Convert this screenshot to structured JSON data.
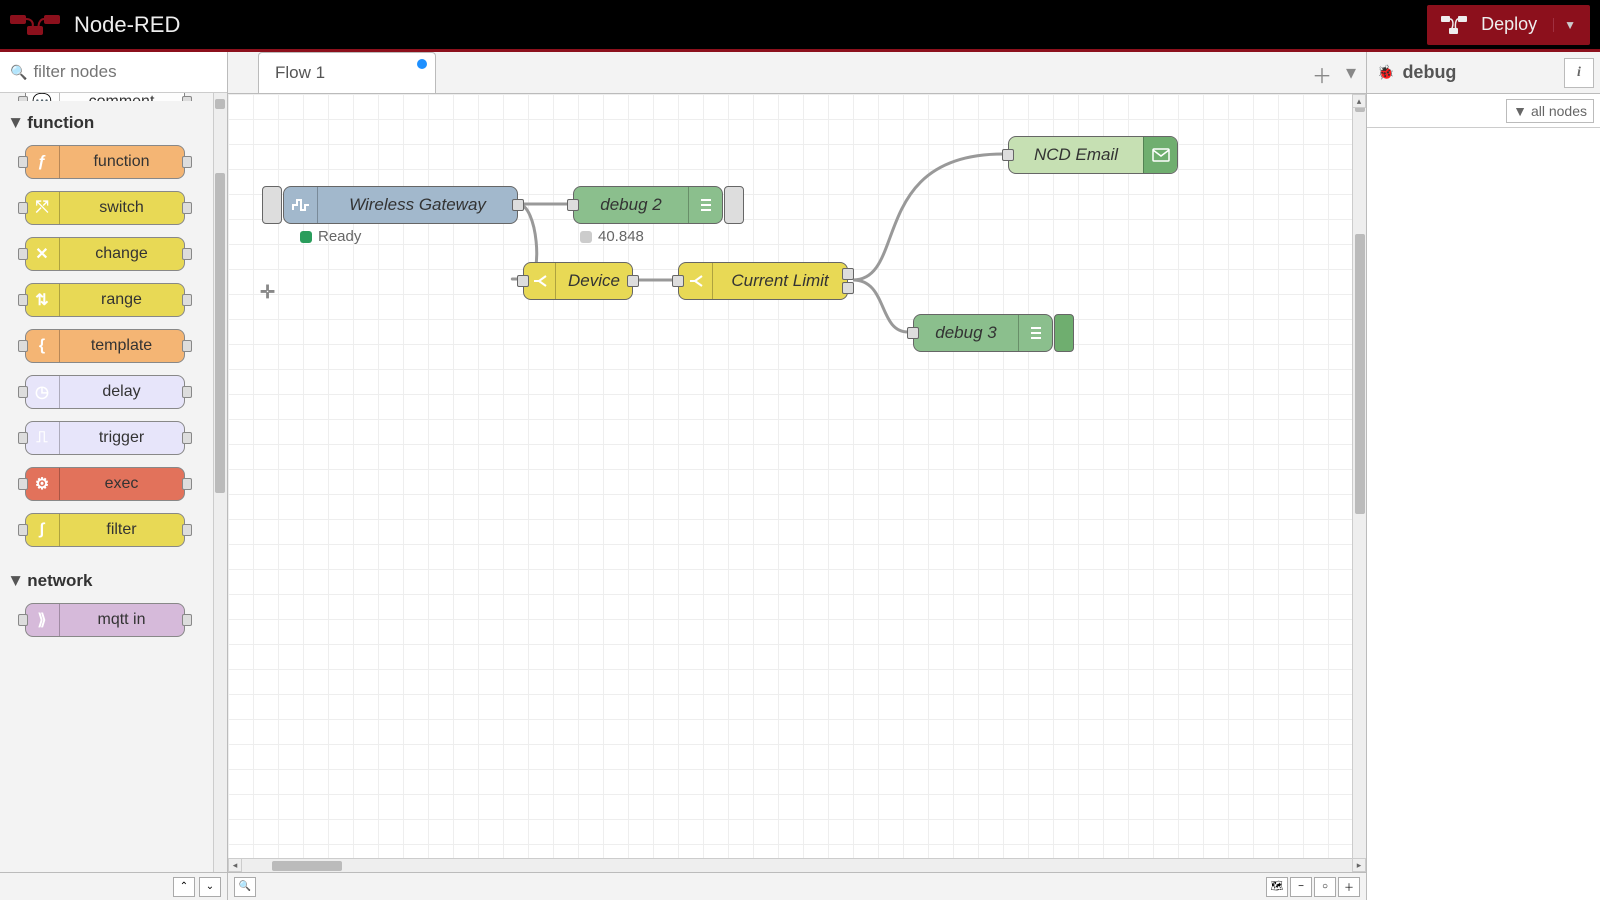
{
  "header": {
    "title": "Node-RED",
    "deploy": "Deploy"
  },
  "palette": {
    "filter_placeholder": "filter nodes",
    "top_node": "comment",
    "categories": [
      {
        "name": "function",
        "items": [
          {
            "label": "function",
            "color": "c-orange",
            "glyph": "ƒ"
          },
          {
            "label": "switch",
            "color": "c-yellow",
            "glyph": "⤲"
          },
          {
            "label": "change",
            "color": "c-yellow",
            "glyph": "✕"
          },
          {
            "label": "range",
            "color": "c-yellow",
            "glyph": "⇅"
          },
          {
            "label": "template",
            "color": "c-orange",
            "glyph": "{"
          },
          {
            "label": "delay",
            "color": "c-lav",
            "glyph": "◷"
          },
          {
            "label": "trigger",
            "color": "c-lav",
            "glyph": "⎍"
          },
          {
            "label": "exec",
            "color": "c-coral",
            "glyph": "⚙"
          },
          {
            "label": "filter",
            "color": "c-yellow",
            "glyph": "∫"
          }
        ]
      },
      {
        "name": "network",
        "items": [
          {
            "label": "mqtt in",
            "color": "c-purple",
            "glyph": "⟫"
          }
        ]
      }
    ]
  },
  "tabs": {
    "active": "Flow 1"
  },
  "flow_nodes": {
    "gateway": {
      "label": "Wireless Gateway",
      "status_text": "Ready"
    },
    "debug2": {
      "label": "debug 2",
      "status_text": "40.848"
    },
    "device": {
      "label": "Device"
    },
    "climit": {
      "label": "Current Limit"
    },
    "email": {
      "label": "NCD Email"
    },
    "debug3": {
      "label": "debug 3"
    }
  },
  "sidebar": {
    "title": "debug",
    "filter": "all nodes"
  }
}
